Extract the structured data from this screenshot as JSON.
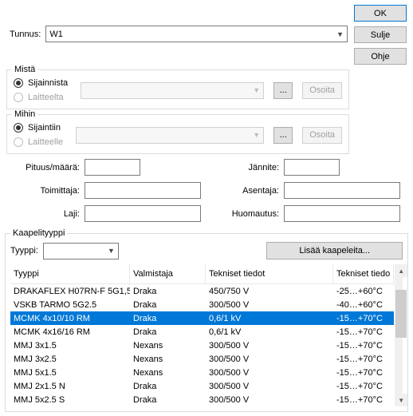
{
  "top": {
    "tunnus_label": "Tunnus:",
    "tunnus_value": "W1",
    "ok": "OK",
    "sulje": "Sulje",
    "ohje": "Ohje"
  },
  "mista": {
    "title": "Mistä",
    "opt1": "Sijainnista",
    "opt2": "Laitteelta",
    "ellipsis": "...",
    "osoita": "Osoita"
  },
  "mihin": {
    "title": "Mihin",
    "opt1": "Sijaintiin",
    "opt2": "Laitteelle",
    "ellipsis": "...",
    "osoita": "Osoita"
  },
  "fields": {
    "pituus": "Pituus/määrä:",
    "jannite": "Jännite:",
    "toimittaja": "Toimittaja:",
    "asentaja": "Asentaja:",
    "laji": "Laji:",
    "huomautus": "Huomautus:"
  },
  "kt": {
    "title": "Kaapelityyppi",
    "tyyppi_label": "Tyyppi:",
    "lisaa": "Lisää kaapeleita..."
  },
  "table": {
    "headers": [
      "Tyyppi",
      "Valmistaja",
      "Tekniset tiedot",
      "Tekniset tiedo"
    ],
    "rows": [
      {
        "c": [
          "DRAKAFLEX H07RN-F 5G1,5",
          "Draka",
          "450/750 V",
          "-25…+60°C"
        ],
        "sel": false
      },
      {
        "c": [
          "VSKB TARMO 5G2.5",
          "Draka",
          "300/500 V",
          "-40…+60°C"
        ],
        "sel": false
      },
      {
        "c": [
          "MCMK 4x10/10 RM",
          "Draka",
          "0,6/1 kV",
          "-15…+70°C"
        ],
        "sel": true
      },
      {
        "c": [
          "MCMK 4x16/16 RM",
          "Draka",
          "0,6/1 kV",
          "-15…+70°C"
        ],
        "sel": false
      },
      {
        "c": [
          "MMJ 3x1.5",
          "Nexans",
          "300/500 V",
          "-15…+70°C"
        ],
        "sel": false
      },
      {
        "c": [
          "MMJ 3x2.5",
          "Nexans",
          "300/500 V",
          "-15…+70°C"
        ],
        "sel": false
      },
      {
        "c": [
          "MMJ 5x1.5",
          "Nexans",
          "300/500 V",
          "-15…+70°C"
        ],
        "sel": false
      },
      {
        "c": [
          "MMJ 2x1.5 N",
          "Draka",
          "300/500 V",
          "-15…+70°C"
        ],
        "sel": false
      },
      {
        "c": [
          "MMJ 5x2.5 S",
          "Draka",
          "300/500 V",
          "-15…+70°C"
        ],
        "sel": false
      }
    ]
  }
}
